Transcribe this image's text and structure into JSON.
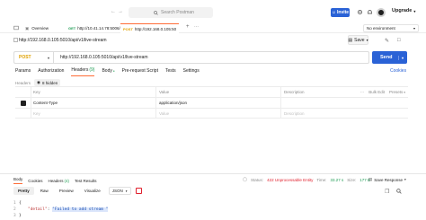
{
  "topbar": {
    "search_placeholder": "Search Postman",
    "invite_label": "Invite",
    "upgrade_label": "Upgrade"
  },
  "tabs": {
    "overview_label": "Overview",
    "tab1_method": "GET",
    "tab1_url": "http://10.41.14.78:5006/",
    "tab2_method": "POST",
    "tab2_url": "http://192.168.0.105:50",
    "env_label": "No environment"
  },
  "request": {
    "breadcrumb": "http://192.168.0.105:5010/api/v1/live-stream",
    "save_label": "Save",
    "method": "POST",
    "url": "http://192.168.0.105:5010/api/v1/live-stream",
    "send_label": "Send",
    "cookies_label": "Cookies"
  },
  "req_tabs": [
    {
      "label": "Params",
      "count": ""
    },
    {
      "label": "Authorization",
      "count": ""
    },
    {
      "label": "Headers",
      "count": "(9)"
    },
    {
      "label": "Body",
      "count": "●"
    },
    {
      "label": "Pre-request Script",
      "count": ""
    },
    {
      "label": "Tests",
      "count": ""
    },
    {
      "label": "Settings",
      "count": ""
    }
  ],
  "headers_section": {
    "label": "Headers",
    "hidden_label": "8 hidden"
  },
  "table": {
    "col_key": "Key",
    "col_value": "Value",
    "col_desc": "Description",
    "bulk_edit": "Bulk Edit",
    "presets": "Presets",
    "rows": [
      {
        "key": "Content-Type",
        "value": "application/json",
        "desc": ""
      }
    ],
    "placeholder": {
      "key": "Key",
      "value": "Value",
      "desc": "Description"
    }
  },
  "response": {
    "tabs": [
      {
        "label": "Body",
        "count": ""
      },
      {
        "label": "Cookies",
        "count": ""
      },
      {
        "label": "Headers",
        "count": "(4)"
      },
      {
        "label": "Test Results",
        "count": ""
      }
    ],
    "status_prefix": "Status:",
    "status_value": "422 Unprocessable Entity",
    "time_prefix": "Time:",
    "time_value": "33.27 s",
    "size_prefix": "Size:",
    "size_value": "177 B",
    "save_label": "Save Response",
    "formats": [
      "Pretty",
      "Raw",
      "Preview",
      "Visualize"
    ],
    "format_type": "JSON",
    "code": {
      "line1": "{",
      "key": "\"detail\"",
      "value": "\"Failed to add stream \"",
      "line3": "}"
    }
  },
  "colors": {
    "accent": "#ff6c37",
    "brand_blue": "#2a62d6",
    "post": "#e0a100",
    "get": "#1f9d55",
    "error": "#e0202d"
  }
}
